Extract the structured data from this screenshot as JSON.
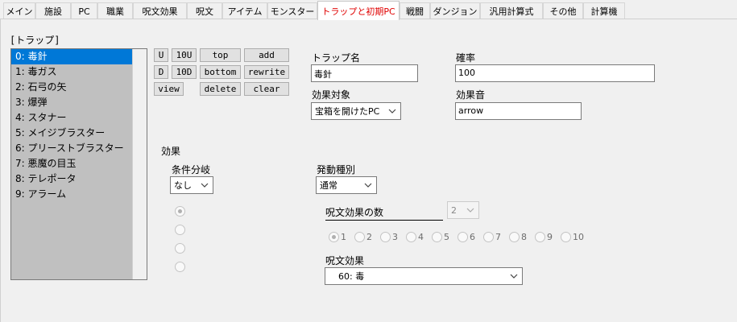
{
  "tabs": [
    "メイン",
    "施設",
    "PC",
    "職業",
    "呪文効果",
    "呪文",
    "アイテム",
    "モンスター",
    "トラップと初期PC",
    "戦闘",
    "ダンジョン",
    "汎用計算式",
    "その他",
    "計算機"
  ],
  "active_tab": "トラップと初期PC",
  "trap_group_label": "[トラップ]",
  "trap_list": [
    "0: 毒針",
    "1: 毒ガス",
    "2: 石弓の矢",
    "3: 爆弾",
    "4: スタナー",
    "5: メイジブラスター",
    "6: プリーストブラスター",
    "7: 悪魔の目玉",
    "8: テレポータ",
    "9: アラーム"
  ],
  "selected_trap_index": 0,
  "buttons": {
    "u": "U",
    "u10": "10U",
    "top": "top",
    "add": "add",
    "d": "D",
    "d10": "10D",
    "bottom": "bottom",
    "rewrite": "rewrite",
    "view": "view",
    "delete": "delete",
    "clear": "clear"
  },
  "trap_name": {
    "label": "トラップ名",
    "value": "毒針"
  },
  "probability": {
    "label": "確率",
    "value": "100"
  },
  "effect_target": {
    "label": "効果対象",
    "value": "宝箱を開けたPC"
  },
  "effect_sound": {
    "label": "効果音",
    "value": "arrow"
  },
  "effect_section_label": "効果",
  "condition": {
    "label": "条件分岐",
    "value": "なし"
  },
  "trigger": {
    "label": "発動種別",
    "value": "通常"
  },
  "spell_count": {
    "label": "呪文効果の数",
    "value": "2"
  },
  "radio_numbers": [
    "1",
    "2",
    "3",
    "4",
    "5",
    "6",
    "7",
    "8",
    "9",
    "10"
  ],
  "selected_radio": 1,
  "spell_effect": {
    "label": "呪文効果",
    "value": "60: 毒"
  },
  "colors": {
    "active_tab_text": "#e00000",
    "selection": "#0078d7",
    "list_bg": "#c0c0c0"
  }
}
